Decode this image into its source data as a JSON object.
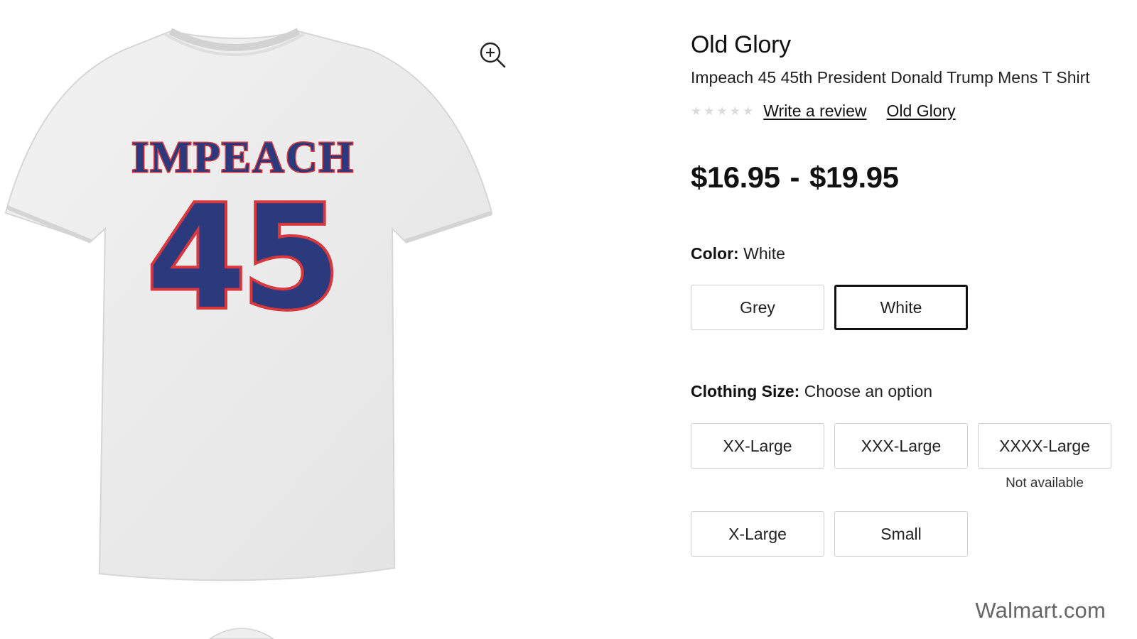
{
  "product": {
    "brand": "Old Glory",
    "title": "Impeach 45 45th President Donald Trump Mens T Shirt",
    "rating_stars": 0,
    "write_review": "Write a review",
    "brand_link": "Old Glory",
    "price_low": "$16.95",
    "price_sep": "-",
    "price_high": "$19.95"
  },
  "image": {
    "print_top": "IMPEACH",
    "print_number": "45"
  },
  "color": {
    "label": "Color:",
    "value": "White",
    "options": [
      "Grey",
      "White"
    ],
    "selected": "White"
  },
  "size": {
    "label": "Clothing Size:",
    "value": "Choose an option",
    "options": [
      "XX-Large",
      "XXX-Large",
      "XXXX-Large",
      "X-Large",
      "Small"
    ],
    "unavailable_note": "Not available"
  },
  "watermark": "Walmart.com",
  "colors": {
    "shirt_navy": "#2a3a7c",
    "shirt_red": "#d9373e",
    "shirt_body": "#ececec"
  },
  "icons": [
    "zoom-in-icon",
    "star-icon"
  ]
}
